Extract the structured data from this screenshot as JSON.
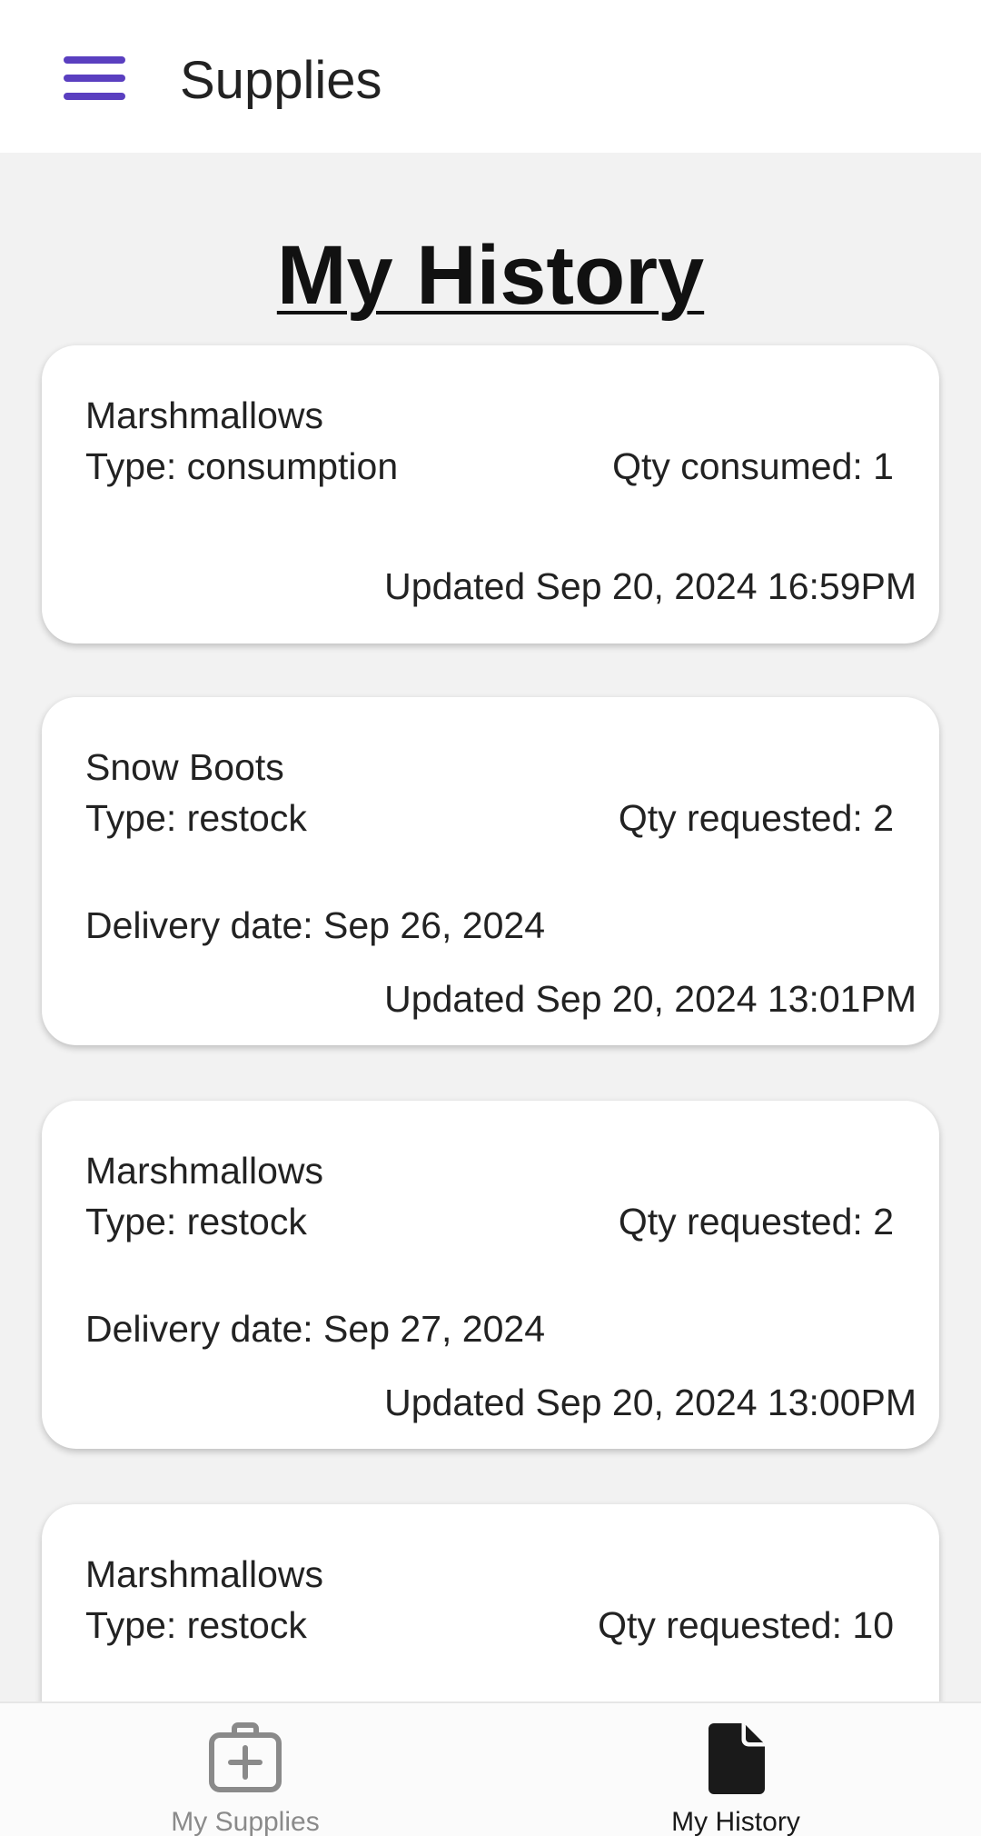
{
  "app_bar": {
    "title": "Supplies",
    "menu_icon": "hamburger-menu-icon",
    "accent_color": "#5a3fc0"
  },
  "page": {
    "heading": "My History"
  },
  "history": [
    {
      "name": "Marshmallows",
      "type": "Type: consumption",
      "qty": "Qty consumed: 1",
      "delivery": "",
      "updated": "Updated Sep 20, 2024 16:59PM"
    },
    {
      "name": "Snow Boots",
      "type": "Type: restock",
      "qty": "Qty requested: 2",
      "delivery": "Delivery date: Sep 26, 2024",
      "updated": "Updated Sep 20, 2024 13:01PM"
    },
    {
      "name": "Marshmallows",
      "type": "Type: restock",
      "qty": "Qty requested: 2",
      "delivery": "Delivery date: Sep 27, 2024",
      "updated": "Updated Sep 20, 2024 13:00PM"
    },
    {
      "name": "Marshmallows",
      "type": "Type: restock",
      "qty": "Qty requested: 10",
      "delivery": "",
      "updated": ""
    }
  ],
  "bottom_nav": {
    "items": [
      {
        "label": "My Supplies",
        "icon": "medical-kit-icon",
        "active": false
      },
      {
        "label": "My History",
        "icon": "document-icon",
        "active": true
      }
    ]
  }
}
